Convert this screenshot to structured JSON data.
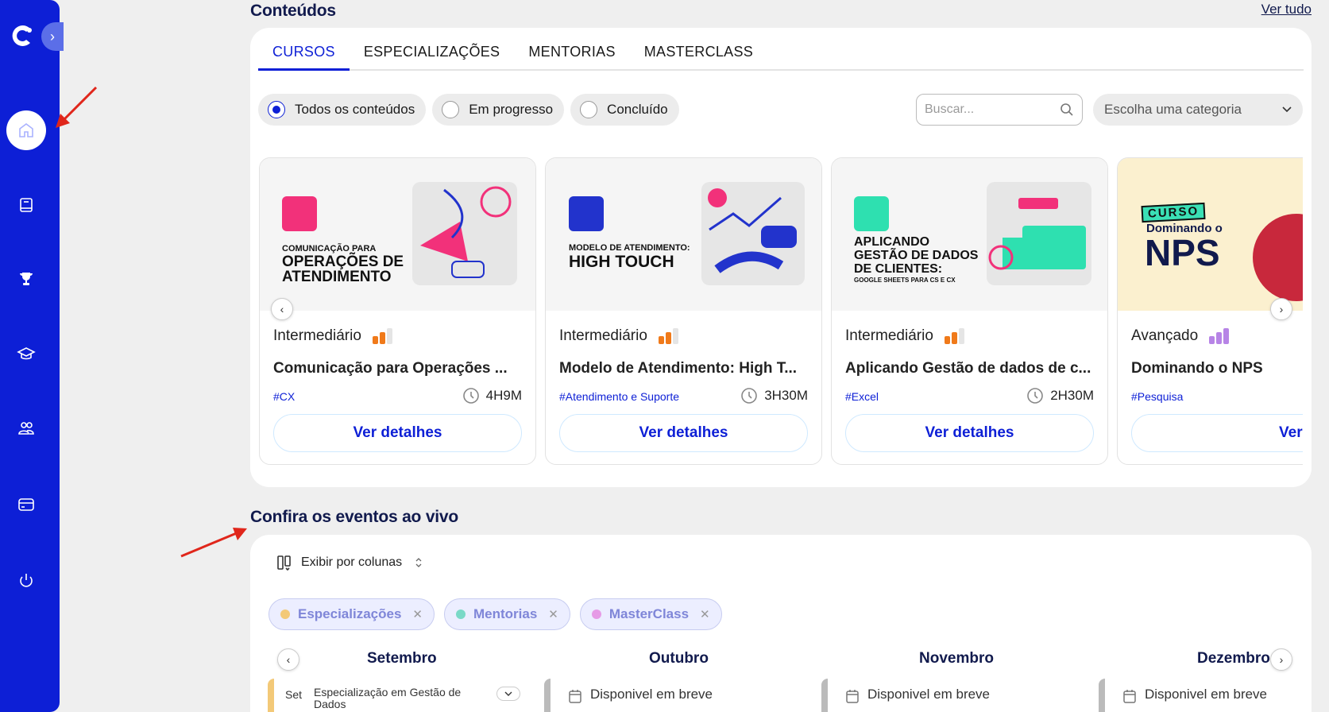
{
  "sidebar": {
    "toggle_glyph": "›",
    "items": [
      {
        "name": "home",
        "active": true
      },
      {
        "name": "book"
      },
      {
        "name": "trophy"
      },
      {
        "name": "graduation-cap"
      },
      {
        "name": "users"
      },
      {
        "name": "card"
      },
      {
        "name": "power"
      }
    ]
  },
  "contents": {
    "title": "Conteúdos",
    "view_all": "Ver tudo",
    "tabs": [
      "CURSOS",
      "ESPECIALIZAÇÕES",
      "MENTORIAS",
      "MASTERCLASS"
    ],
    "active_tab": 0,
    "filters": [
      "Todos os conteúdos",
      "Em progresso",
      "Concluído"
    ],
    "search_placeholder": "Buscar...",
    "category_placeholder": "Escolha uma categoria",
    "cards": [
      {
        "image_text": [
          "COMUNICAÇÃO PARA",
          "OPERAÇÕES DE",
          "ATENDIMENTO"
        ],
        "level": "Intermediário",
        "title": "Comunicação para Operações ...",
        "tag": "#CX",
        "duration": "4H9M",
        "button": "Ver detalhes"
      },
      {
        "image_text": [
          "MODELO DE ATENDIMENTO:",
          "HIGH TOUCH"
        ],
        "level": "Intermediário",
        "title": "Modelo de Atendimento: High T...",
        "tag": "#Atendimento e Suporte",
        "duration": "3H30M",
        "button": "Ver detalhes"
      },
      {
        "image_text": [
          "APLICANDO",
          "GESTÃO DE DADOS",
          "DE CLIENTES:",
          "GOOGLE SHEETS PARA CS E CX"
        ],
        "level": "Intermediário",
        "title": "Aplicando Gestão de dados de c...",
        "tag": "#Excel",
        "duration": "2H30M",
        "button": "Ver detalhes"
      },
      {
        "image_text": [
          "CURSO",
          "Dominando o",
          "NPS"
        ],
        "level": "Avançado",
        "title": "Dominando o NPS",
        "tag": "#Pesquisa",
        "duration": "",
        "button": "Ver detalhes"
      }
    ]
  },
  "events": {
    "title": "Confira os eventos ao vivo",
    "view_mode": "Exibir por colunas",
    "chips": [
      {
        "label": "Especializações",
        "color": "#f3c978"
      },
      {
        "label": "Mentorias",
        "color": "#7ad9c7"
      },
      {
        "label": "MasterClass",
        "color": "#e69be6"
      }
    ],
    "months": [
      "Setembro",
      "Outubro",
      "Novembro",
      "Dezembro"
    ],
    "first_event": {
      "month_abbr": "Set",
      "title": "Especialização em Gestão de Dados"
    },
    "placeholder": "Disponivel em breve"
  },
  "colors": {
    "brand": "#0d1fd6",
    "level_intermediate": "#f07a1a",
    "level_advanced": "#b784e6"
  }
}
